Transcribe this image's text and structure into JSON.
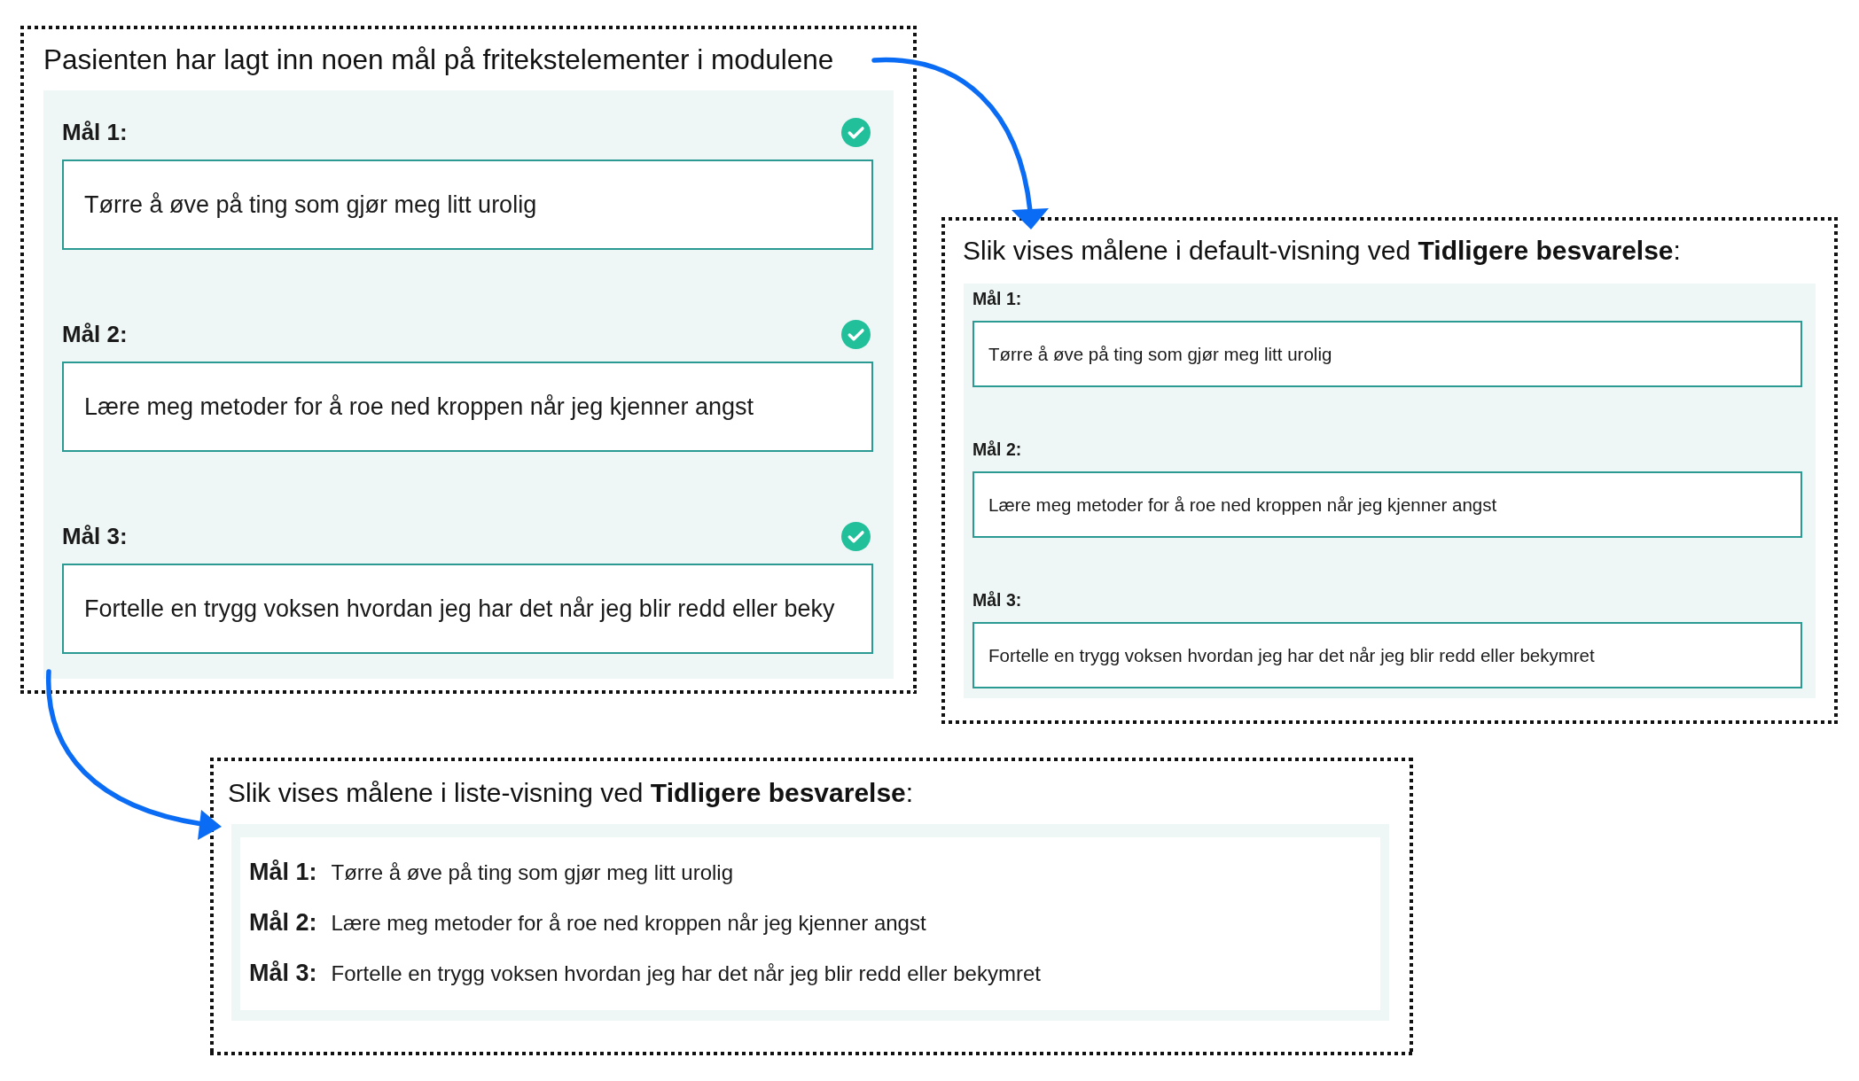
{
  "entry_panel": {
    "caption": "Pasienten har lagt inn noen mål på fritekstelementer i modulene",
    "goals": [
      {
        "label": "Mål 1:",
        "value": "Tørre å øve på ting som gjør meg litt urolig",
        "completed": true
      },
      {
        "label": "Mål 2:",
        "value": "Lære meg metoder for å roe ned kroppen når jeg kjenner angst",
        "completed": true
      },
      {
        "label": "Mål 3:",
        "value": "Fortelle en trygg voksen hvordan jeg har det når jeg blir redd eller beky",
        "completed": true
      }
    ]
  },
  "default_view_panel": {
    "caption": "Slik vises målene i default-visning ved **Tidligere besvarelse**:",
    "goals": [
      {
        "label": "Mål 1:",
        "value": "Tørre å øve på ting som gjør meg litt urolig"
      },
      {
        "label": "Mål 2:",
        "value": "Lære meg metoder for å roe ned kroppen når jeg kjenner angst"
      },
      {
        "label": "Mål 3:",
        "value": "Fortelle en trygg voksen hvordan jeg har det når jeg blir redd eller bekymret"
      }
    ]
  },
  "list_view_panel": {
    "caption": "Slik vises målene i liste-visning ved **Tidligere besvarelse**:",
    "goals": [
      {
        "label": "Mål 1:",
        "value": "Tørre å øve på ting som gjør meg litt urolig"
      },
      {
        "label": "Mål 2:",
        "value": "Lære meg metoder for å roe ned kroppen når jeg kjenner angst"
      },
      {
        "label": "Mål 3:",
        "value": "Fortelle en trygg voksen hvordan jeg har det når jeg blir redd eller bekymret"
      }
    ]
  }
}
